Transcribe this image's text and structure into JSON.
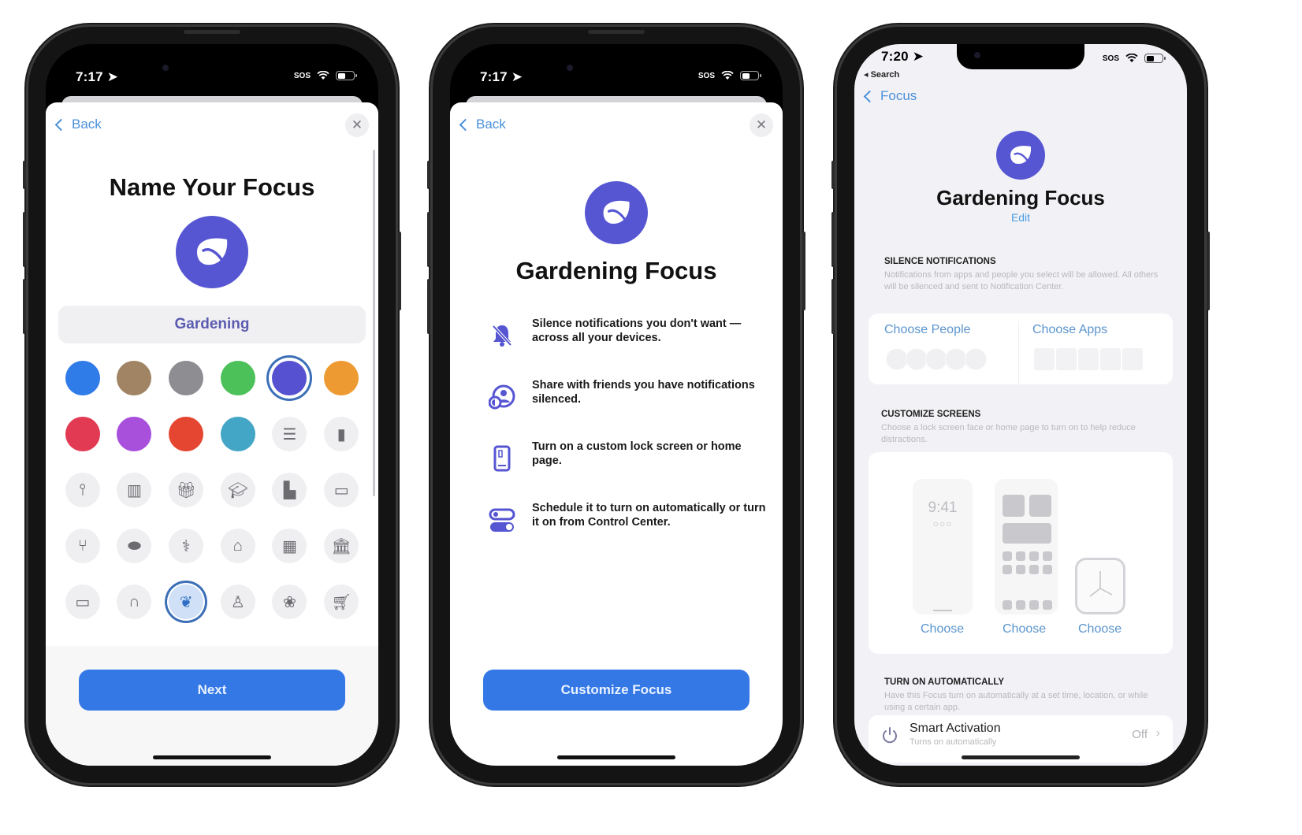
{
  "accent_colors": {
    "focus_purple": "#5656d3",
    "ios_blue": "#3478e6",
    "link_blue": "#4a90d9"
  },
  "phone1": {
    "status": {
      "time": "7:17",
      "carrier": "SOS"
    },
    "nav": {
      "back_label": "Back",
      "close_icon": "close-icon"
    },
    "title": "Name Your Focus",
    "focus_icon": "leaf-icon",
    "name_field_value": "Gardening",
    "color_swatches": [
      {
        "name": "blue",
        "color": "#2f7be8",
        "selected": false
      },
      {
        "name": "brown",
        "color": "#a08463",
        "selected": false
      },
      {
        "name": "gray",
        "color": "#8e8e92",
        "selected": false
      },
      {
        "name": "green",
        "color": "#4cc15a",
        "selected": false
      },
      {
        "name": "indigo",
        "color": "#5651d0",
        "selected": true
      },
      {
        "name": "orange",
        "color": "#ee9a32",
        "selected": false
      },
      {
        "name": "red",
        "color": "#e23a52",
        "selected": false
      },
      {
        "name": "purple",
        "color": "#a84fdc",
        "selected": false
      },
      {
        "name": "red-orange",
        "color": "#e44632",
        "selected": false
      },
      {
        "name": "teal",
        "color": "#44a6c6",
        "selected": false
      }
    ],
    "glyphs": [
      {
        "name": "list-icon",
        "char": "☰",
        "selected": false
      },
      {
        "name": "bookmark-icon",
        "char": "▮",
        "selected": false
      },
      {
        "name": "pin-icon",
        "char": "⫯",
        "selected": false
      },
      {
        "name": "books-icon",
        "char": "▥",
        "selected": false
      },
      {
        "name": "gift-icon",
        "char": "🎁︎",
        "selected": false
      },
      {
        "name": "graduation-cap-icon",
        "char": "🎓︎",
        "selected": false
      },
      {
        "name": "document-icon",
        "char": "▙",
        "selected": false
      },
      {
        "name": "credit-card-icon",
        "char": "▭",
        "selected": false
      },
      {
        "name": "fork-knife-icon",
        "char": "⑂",
        "selected": false
      },
      {
        "name": "pills-icon",
        "char": "⬬",
        "selected": false
      },
      {
        "name": "stethoscope-icon",
        "char": "⚕",
        "selected": false
      },
      {
        "name": "house-icon",
        "char": "⌂",
        "selected": false
      },
      {
        "name": "building-icon",
        "char": "▦",
        "selected": false
      },
      {
        "name": "bank-icon",
        "char": "🏛︎",
        "selected": false
      },
      {
        "name": "tv-icon",
        "char": "▭",
        "selected": false
      },
      {
        "name": "headphones-icon",
        "char": "∩",
        "selected": false
      },
      {
        "name": "leaf-icon",
        "char": "❦",
        "selected": true
      },
      {
        "name": "person-icon",
        "char": "♙",
        "selected": false
      },
      {
        "name": "paw-icon",
        "char": "❀",
        "selected": false
      },
      {
        "name": "cart-icon",
        "char": "🛒︎",
        "selected": false
      }
    ],
    "next_label": "Next"
  },
  "phone2": {
    "status": {
      "time": "7:17",
      "carrier": "SOS"
    },
    "nav": {
      "back_label": "Back"
    },
    "title": "Gardening Focus",
    "features": [
      {
        "icon": "bell-slash-icon",
        "text": "Silence notifications you don't want — across all your devices."
      },
      {
        "icon": "share-people-icon",
        "text": "Share with friends you have notifications silenced."
      },
      {
        "icon": "phone-screen-icon",
        "text": "Turn on a custom lock screen or home page."
      },
      {
        "icon": "toggles-icon",
        "text": "Schedule it to turn on automatically or turn it on from Control Center."
      }
    ],
    "customize_label": "Customize Focus"
  },
  "phone3": {
    "status": {
      "time": "7:20",
      "carrier": "SOS",
      "back_to_app": "◂ Search"
    },
    "nav": {
      "back_label": "Focus"
    },
    "title": "Gardening Focus",
    "edit_label": "Edit",
    "silence": {
      "heading": "SILENCE NOTIFICATIONS",
      "description": "Notifications from apps and people you select will be allowed. All others will be silenced and sent to Notification Center.",
      "choose_people": "Choose People",
      "choose_apps": "Choose Apps"
    },
    "customize": {
      "heading": "CUSTOMIZE SCREENS",
      "description": "Choose a lock screen face or home page to turn on to help reduce distractions.",
      "lock_time": "9:41",
      "choose_lock": "Choose",
      "choose_home": "Choose",
      "choose_watch": "Choose"
    },
    "auto": {
      "heading": "TURN ON AUTOMATICALLY",
      "description": "Have this Focus turn on automatically at a set time, location, or while using a certain app.",
      "smart_title": "Smart Activation",
      "smart_subtitle": "Turns on automatically",
      "smart_value": "Off"
    }
  }
}
